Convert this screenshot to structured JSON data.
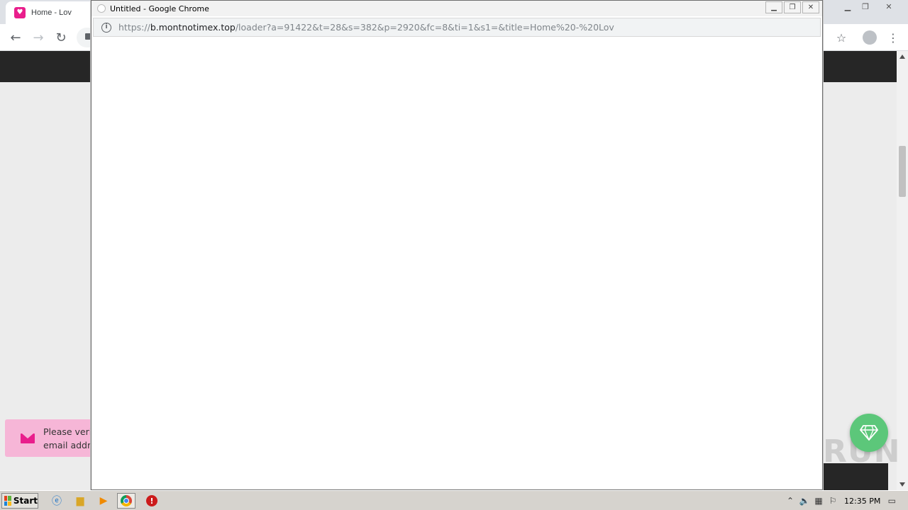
{
  "background_window": {
    "tab_title": "Home - Lov",
    "notification": {
      "text": "Please verify your email address!"
    }
  },
  "popup_window": {
    "title": "Untitled - Google Chrome",
    "url_scheme": "https://",
    "url_host": "b.montnotimex.top",
    "url_rest": "/loader?a=91422&t=28&s=382&p=2920&fc=8&ti=1&s1=&title=Home%20-%20Lov"
  },
  "watermark": "ANY RUN",
  "taskbar": {
    "start_label": "Start",
    "clock": "12:35 PM"
  },
  "colors": {
    "brand_pink": "#e91e8c",
    "toast_bg": "#f6b6d7",
    "gem_green": "#5cc77a",
    "header_dark": "#262626"
  }
}
